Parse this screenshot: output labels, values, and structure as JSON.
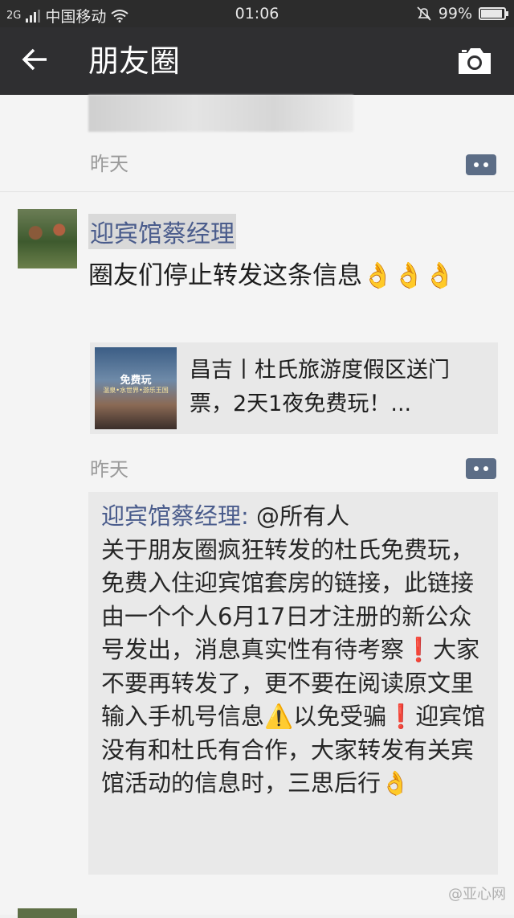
{
  "status_bar": {
    "signal_label": "2G",
    "carrier": "中国移动",
    "time": "01:06",
    "battery": "99%",
    "battery_level": 0.99
  },
  "nav": {
    "title": "朋友圈"
  },
  "previous_post": {
    "time": "昨天"
  },
  "post": {
    "author": "迎宾馆蔡经理",
    "text": "圈友们停止转发这条信息👌👌👌",
    "link": {
      "thumb_title": "免费玩",
      "thumb_sub": "温泉•水世界•游乐王国",
      "title": "昌吉丨杜氏旅游度假区送门票，2天1夜免费玩！..."
    },
    "time": "昨天",
    "comment": {
      "author": "迎宾馆蔡经理:",
      "mention": " @所有人",
      "body": "关于朋友圈疯狂转发的杜氏免费玩，免费入住迎宾馆套房的链接，此链接由一个个人6月17日才注册的新公众号发出，消息真实性有待考察❗大家不要再转发了，更不要在阅读原文里输入手机号信息⚠️以免受骗❗迎宾馆没有和杜氏有合作，大家转发有关宾馆活动的信息时，三思后行👌"
    }
  },
  "watermark": "@亚心网",
  "icons": {
    "back": "arrow-left-icon",
    "camera": "camera-icon",
    "comment": "comment-dots-icon",
    "wifi": "wifi-icon",
    "mute": "bell-slash-icon"
  }
}
